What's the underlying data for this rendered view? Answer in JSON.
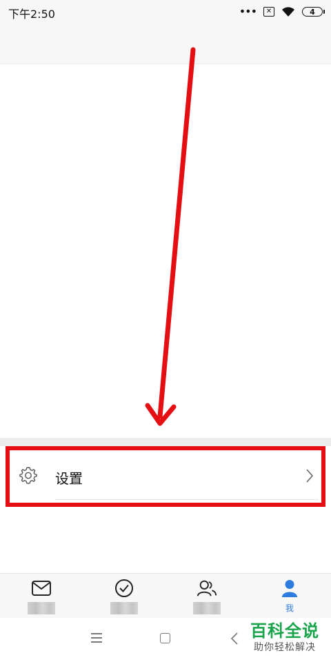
{
  "status_bar": {
    "time": "下午2:50",
    "dots": "•••",
    "battery_level": "4"
  },
  "settings": {
    "label": "设置"
  },
  "bottom_nav": {
    "items": [
      {
        "icon": "mail-icon",
        "label": ""
      },
      {
        "icon": "check-circle-icon",
        "label": ""
      },
      {
        "icon": "contacts-icon",
        "label": ""
      },
      {
        "icon": "person-icon",
        "label": "我"
      }
    ],
    "active_color": "#2d7de0"
  },
  "watermark": {
    "main": "百科全说",
    "sub": "助你轻松解决"
  },
  "colors": {
    "highlight": "#e50f13",
    "watermark_green": "#19a34a"
  }
}
